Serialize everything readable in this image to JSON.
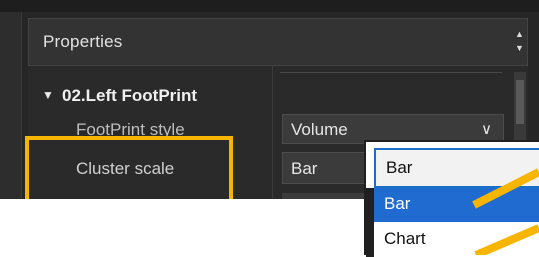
{
  "properties": {
    "title": "Properties",
    "scroll_up_icon": "scroll-up-icon",
    "scroll_down_icon": "scroll-down-icon"
  },
  "section": {
    "title": "02.Left FootPrint",
    "expand_icon": "triangle-down-icon"
  },
  "rows": [
    {
      "label": "FootPrint style",
      "value": "Volume"
    },
    {
      "label": "Cluster scale",
      "value": "Bar"
    }
  ],
  "dropdown": {
    "current": "Bar",
    "options": [
      "Bar",
      "Chart"
    ],
    "selected_index": 0
  },
  "colors": {
    "highlight": "#f7b500",
    "selection": "#1f6bd0",
    "panel_bg": "#262626"
  }
}
